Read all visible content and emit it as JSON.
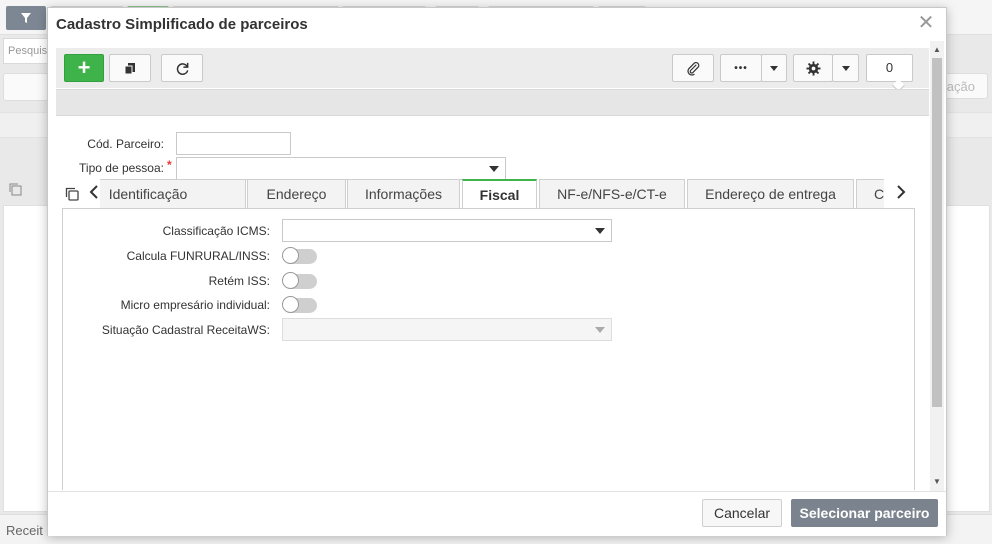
{
  "background": {
    "search_placeholder": "Pesquis",
    "right_button_label": "ação",
    "footer_label": "Receit"
  },
  "modal": {
    "title": "Cadastro Simplificado de parceiros",
    "close_symbol": "✕"
  },
  "toolbar": {
    "add_symbol": "+",
    "more_symbol": "•••",
    "dropdown_symbol": "▾",
    "counter": "0"
  },
  "form": {
    "codigo_label": "Cód. Parceiro:",
    "codigo_value": "",
    "tipo_pessoa_label": "Tipo de pessoa:",
    "required_mark": "*",
    "tipo_pessoa_value": ""
  },
  "tabs": [
    {
      "label": "Identificação"
    },
    {
      "label": "Endereço"
    },
    {
      "label": "Informações"
    },
    {
      "label": "Fiscal"
    },
    {
      "label": "NF-e/NFS-e/CT-e"
    },
    {
      "label": "Endereço de entrega"
    },
    {
      "label": "Contatos"
    }
  ],
  "active_tab": "Fiscal",
  "fiscal": {
    "classificacao_label": "Classificação ICMS:",
    "classificacao_value": "",
    "funrural_label": "Calcula FUNRURAL/INSS:",
    "funrural_on": false,
    "iss_label": "Retém ISS:",
    "iss_on": false,
    "micro_label": "Micro empresário individual:",
    "micro_on": false,
    "situacao_label": "Situação Cadastral ReceitaWS:",
    "situacao_value": ""
  },
  "footer": {
    "cancel_label": "Cancelar",
    "select_label": "Selecionar parceiro"
  },
  "colors": {
    "accent_green": "#3db34a",
    "primary_button": "#7b848e",
    "required": "#e53935"
  }
}
